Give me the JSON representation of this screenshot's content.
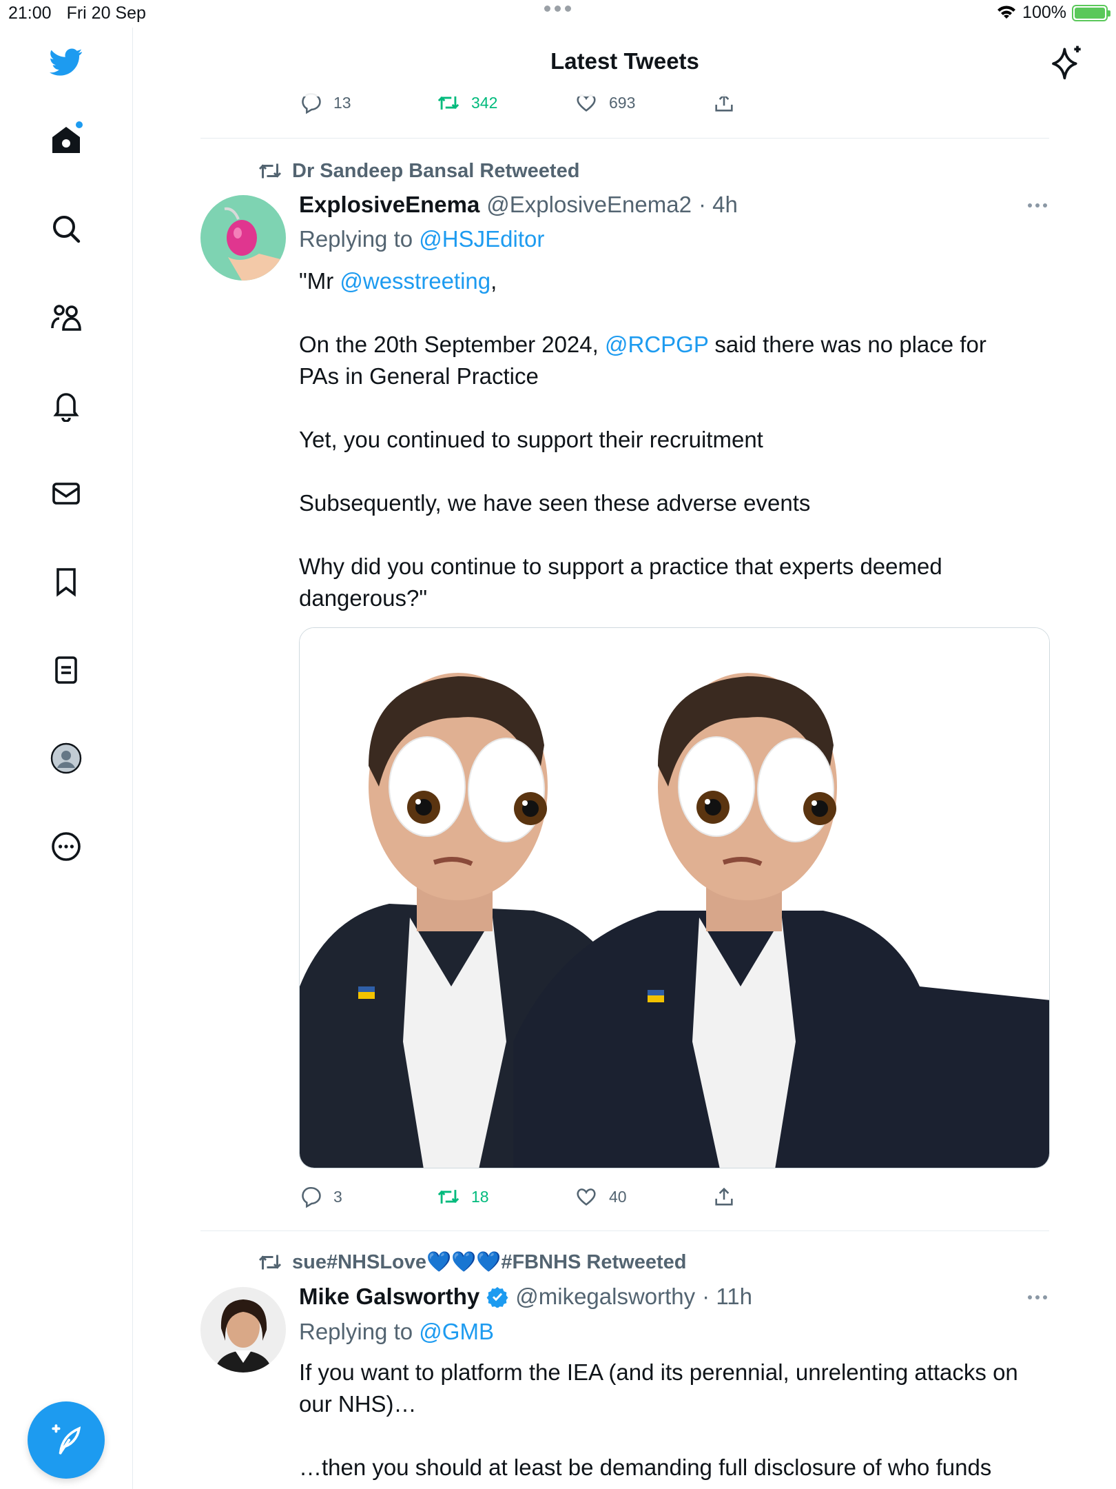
{
  "status": {
    "time": "21:00",
    "date": "Fri 20 Sep",
    "battery": "100%"
  },
  "header": {
    "title": "Latest Tweets"
  },
  "sidebar": {
    "items": [
      {
        "name": "home-icon"
      },
      {
        "name": "search-icon"
      },
      {
        "name": "communities-icon"
      },
      {
        "name": "notifications-icon"
      },
      {
        "name": "messages-icon"
      },
      {
        "name": "bookmarks-icon"
      },
      {
        "name": "lists-icon"
      },
      {
        "name": "profile-icon"
      },
      {
        "name": "more-icon"
      }
    ]
  },
  "prev_tweet": {
    "replies": "13",
    "retweets": "342",
    "likes": "693"
  },
  "tweet1": {
    "retweeted_by": "Dr Sandeep Bansal Retweeted",
    "name": "ExplosiveEnema",
    "handle": "@ExplosiveEnema2",
    "time": "· 4h",
    "replying_label": "Replying to",
    "replying_to": "@HSJEditor",
    "p1_pre": "\"Mr ",
    "p1_mention": "@wesstreeting",
    "p1_post": ",",
    "p2_pre": "On the 20th September 2024, ",
    "p2_mention": "@RCPGP",
    "p2_post": " said there was no place for PAs in General Practice",
    "p3": "Yet, you continued to support their recruitment",
    "p4": "Subsequently, we have seen these adverse events",
    "p5": "Why did you continue to support a practice that experts deemed dangerous?\"",
    "replies": "3",
    "retweets": "18",
    "likes": "40"
  },
  "tweet2": {
    "retweeted_by": "sue#NHSLove💙💙💙#FBNHS Retweeted",
    "name": "Mike Galsworthy",
    "handle": "@mikegalsworthy",
    "time": "· 11h",
    "replying_label": "Replying to",
    "replying_to": "@GMB",
    "p1": "If you want to platform the IEA (and its perennial, unrelenting attacks on our NHS)…",
    "p2": "…then you should at least be demanding full disclosure of who funds"
  },
  "colors": {
    "accent": "#1d9bf0",
    "retweet_green": "#00ba7c",
    "muted": "#536471"
  }
}
